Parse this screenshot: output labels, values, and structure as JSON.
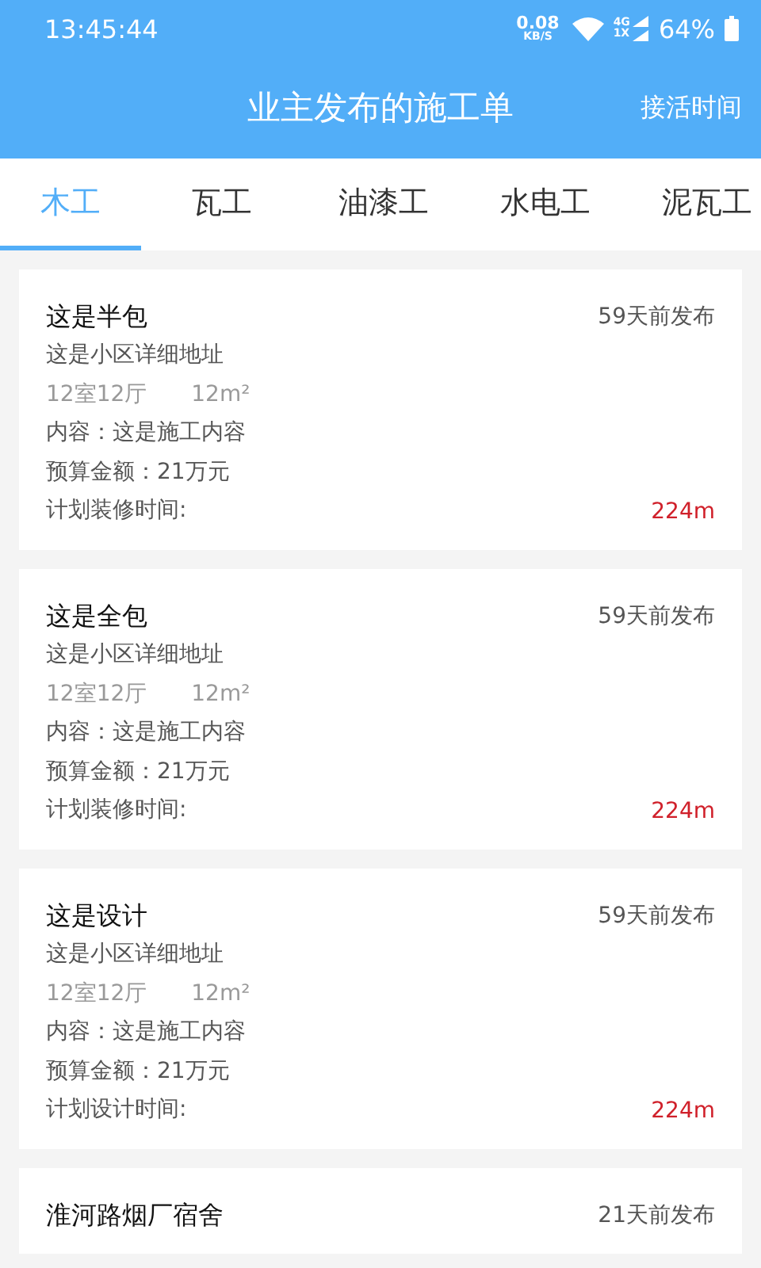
{
  "status_bar": {
    "time": "13:45:44",
    "speed": "0.08",
    "speed_unit": "KB/S",
    "network_top": "4G",
    "network_bottom": "1X",
    "battery": "64%"
  },
  "header": {
    "title": "业主发布的施工单",
    "action": "接活时间"
  },
  "tabs": [
    {
      "label": "木工",
      "selected": true
    },
    {
      "label": "瓦工",
      "selected": false
    },
    {
      "label": "油漆工",
      "selected": false
    },
    {
      "label": "水电工",
      "selected": false
    },
    {
      "label": "泥瓦工",
      "selected": false
    }
  ],
  "orders": [
    {
      "title": "这是半包",
      "posted": "59天前发布",
      "address": "这是小区详细地址",
      "rooms": "12室12厅",
      "area": "12m²",
      "content": "内容：这是施工内容",
      "budget": "预算金额：21万元",
      "plan": "计划装修时间:",
      "distance": "224m"
    },
    {
      "title": "这是全包",
      "posted": "59天前发布",
      "address": "这是小区详细地址",
      "rooms": "12室12厅",
      "area": "12m²",
      "content": "内容：这是施工内容",
      "budget": "预算金额：21万元",
      "plan": "计划装修时间:",
      "distance": "224m"
    },
    {
      "title": "这是设计",
      "posted": "59天前发布",
      "address": "这是小区详细地址",
      "rooms": "12室12厅",
      "area": "12m²",
      "content": "内容：这是施工内容",
      "budget": "预算金额：21万元",
      "plan": "计划设计时间:",
      "distance": "224m"
    },
    {
      "title": "淮河路烟厂宿舍",
      "posted": "21天前发布"
    }
  ]
}
